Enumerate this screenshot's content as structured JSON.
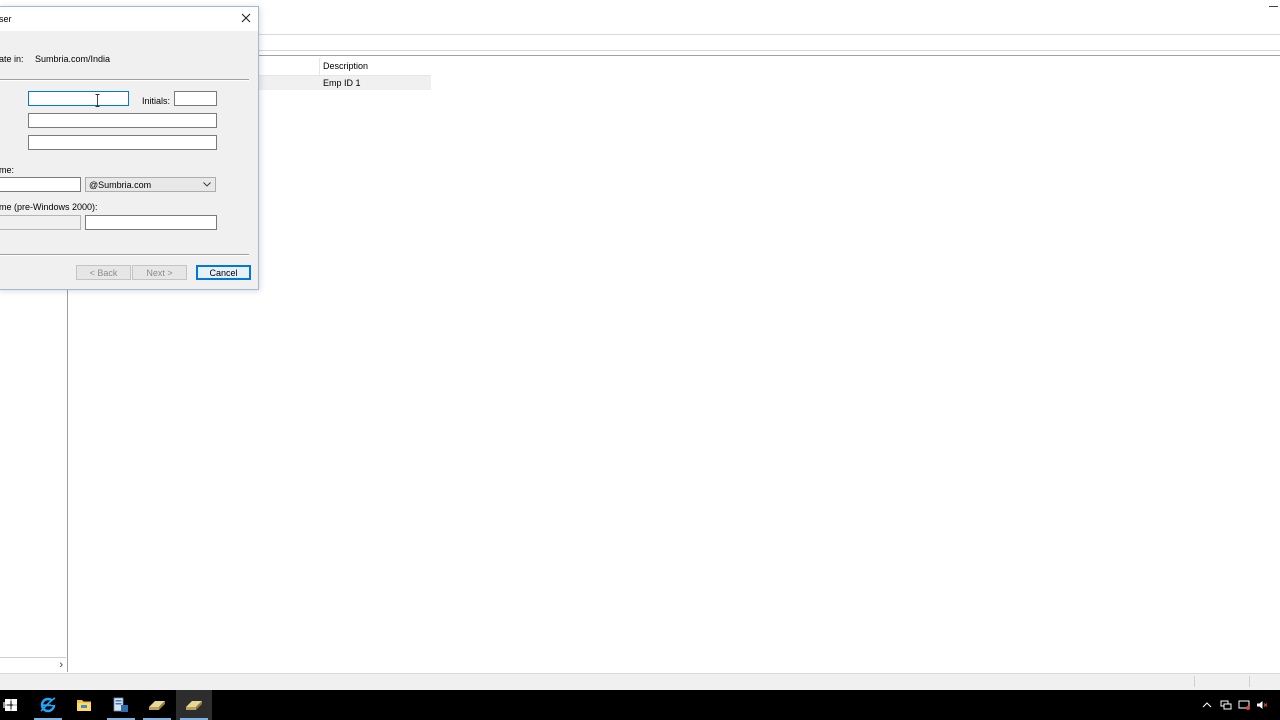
{
  "background_window": {
    "list": {
      "columns": [
        "Description"
      ],
      "rows": [
        {
          "description": "Emp ID 1"
        }
      ]
    }
  },
  "dialog": {
    "title": "ser",
    "create_in_label": "ate in:",
    "create_in_value": "Sumbria.com/India",
    "initials_label": "Initials:",
    "first_name_value": "",
    "initials_value": "",
    "last_name_value": "",
    "full_name_value": "",
    "logon_name_label": "me:",
    "logon_name_value": "",
    "upn_suffix_selected": "@Sumbria.com",
    "prewin_label": "me (pre-Windows 2000):",
    "prewin_domain_value": "",
    "prewin_logon_value": "",
    "buttons": {
      "back": "< Back",
      "next": "Next >",
      "cancel": "Cancel"
    }
  },
  "taskbar": {
    "icons": [
      "start-icon",
      "task-view-icon",
      "internet-explorer-icon",
      "file-explorer-icon",
      "server-manager-icon",
      "ad-users-computers-icon",
      "ad-users-computers-icon-active"
    ],
    "tray_icons": [
      "chevron-up-icon",
      "network-icon",
      "action-center-icon",
      "volume-muted-icon"
    ]
  },
  "colors": {
    "accent": "#0078d7",
    "taskbar": "#000000",
    "dialog_bg": "#f0f0f0"
  }
}
